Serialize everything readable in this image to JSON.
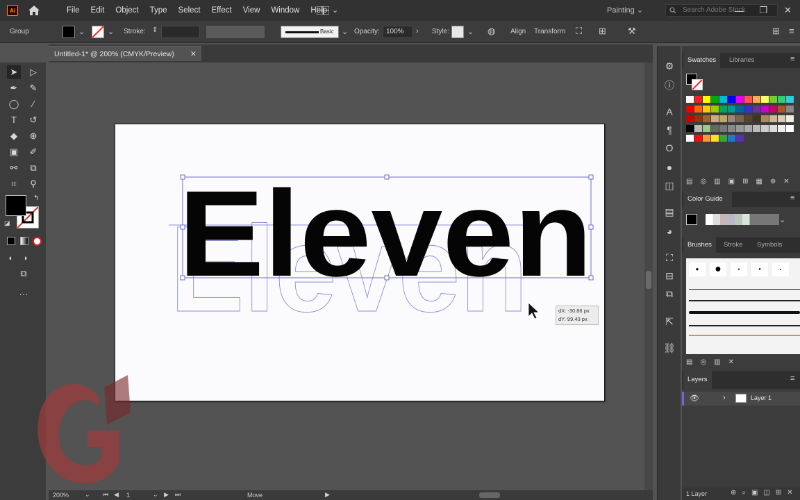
{
  "menubar": {
    "logo": "Ai",
    "items": [
      "File",
      "Edit",
      "Object",
      "Type",
      "Select",
      "Effect",
      "View",
      "Window",
      "Help"
    ],
    "workspace": "Painting",
    "search_placeholder": "Search Adobe Stock"
  },
  "controlbar": {
    "selection_label": "Group",
    "stroke_label": "Stroke:",
    "brush_style": "Basic",
    "opacity_label": "Opacity:",
    "opacity_value": "100%",
    "style_label": "Style:",
    "align_label": "Align",
    "transform_label": "Transform"
  },
  "document": {
    "tab_title": "Untitled-1* @ 200% (CMYK/Preview)",
    "artwork_text": "Eleven",
    "outline_text": "Eleven",
    "move_tooltip": [
      "dX: -30.86 px",
      "dY: 99.43 px"
    ]
  },
  "statusbar": {
    "zoom": "200%",
    "artboard": "1",
    "tool_status": "Move"
  },
  "panels": {
    "swatches_tabs": [
      "Swatches",
      "Libraries"
    ],
    "color_guide_tab": "Color Guide",
    "brush_tabs": [
      "Brushes",
      "Stroke",
      "Symbols"
    ],
    "layers_tab": "Layers",
    "layer_name": "Layer 1",
    "layers_count": "1 Layer"
  },
  "colors": {
    "accent_selection": "#6b6bd6",
    "ui_dark": "#323232",
    "panel": "#3c3c3c",
    "canvas": "#535353"
  }
}
